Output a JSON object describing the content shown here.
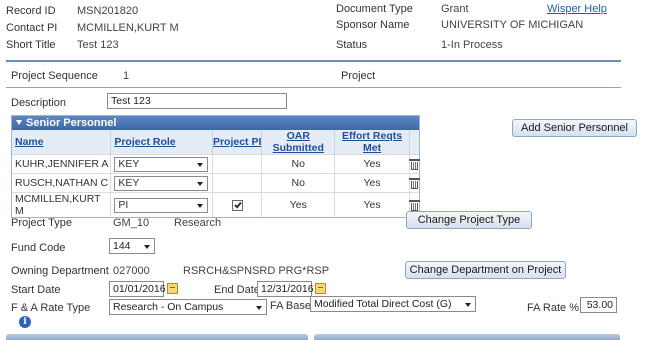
{
  "header": {
    "record_id_label": "Record ID",
    "record_id": "MSN201820",
    "contact_pi_label": "Contact PI",
    "contact_pi": "MCMILLEN,KURT M",
    "short_title_label": "Short Title",
    "short_title": "Test 123",
    "document_type_label": "Document Type",
    "document_type": "Grant",
    "wisper_help": "Wisper Help",
    "sponsor_name_label": "Sponsor Name",
    "sponsor_name": "UNIVERSITY OF MICHIGAN",
    "status_label": "Status",
    "status": "1-In Process"
  },
  "project": {
    "sequence_label": "Project Sequence",
    "sequence": "1",
    "project_label": "Project",
    "description_label": "Description",
    "description": "Test 123"
  },
  "senior_personnel": {
    "title": "Senior Personnel",
    "add_button": "Add Senior Personnel",
    "columns": [
      "Name",
      "Project Role",
      "Project PI",
      "OAR Submitted",
      "Effort Reqts Met"
    ],
    "rows": [
      {
        "name": "KUHR,JENNIFER A",
        "role": "KEY",
        "project_pi": false,
        "oar": "No",
        "effort": "Yes"
      },
      {
        "name": "RUSCH,NATHAN C",
        "role": "KEY",
        "project_pi": false,
        "oar": "No",
        "effort": "Yes"
      },
      {
        "name": "MCMILLEN,KURT M",
        "role": "PI",
        "project_pi": true,
        "oar": "Yes",
        "effort": "Yes"
      }
    ]
  },
  "details": {
    "project_type_label": "Project Type",
    "project_type_code": "GM_10",
    "project_type_desc": "Research",
    "change_project_type_button": "Change Project Type",
    "fund_code_label": "Fund Code",
    "fund_code": "144",
    "owning_dept_label": "Owning Department",
    "owning_dept_code": "027000",
    "owning_dept_desc": "RSRCH&SPNSRD PRG*RSP",
    "change_dept_button": "Change Department on Project",
    "start_date_label": "Start Date",
    "start_date": "01/01/2016",
    "end_date_label": "End Date",
    "end_date": "12/31/2016",
    "fa_rate_type_label": "F & A Rate Type",
    "fa_rate_type": "Research - On Campus",
    "fa_base_label": "FA Base",
    "fa_base": "Modified Total Direct Cost (G)",
    "fa_rate_label": "FA Rate %",
    "fa_rate": "53.00"
  },
  "colors": {
    "accent": "#3d67a8",
    "link": "#1f5fa8"
  }
}
